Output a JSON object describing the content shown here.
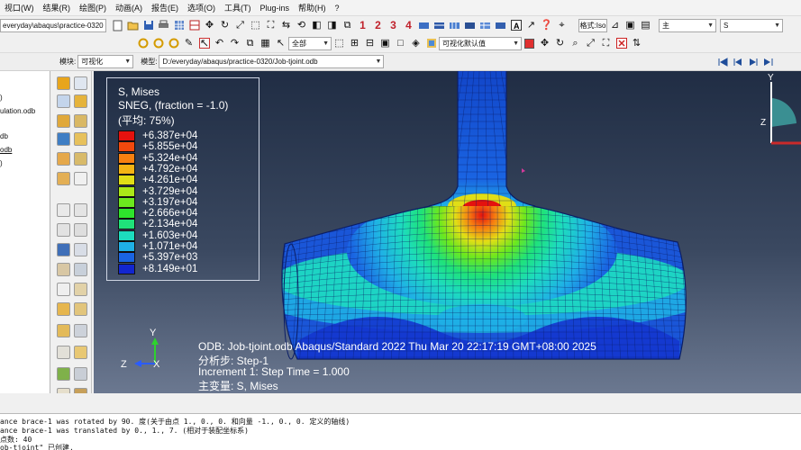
{
  "menu": [
    "视口(W)",
    "结果(R)",
    "绘图(P)",
    "动画(A)",
    "报告(E)",
    "选项(O)",
    "工具(T)",
    "Plug-ins",
    "帮助(H)",
    "?"
  ],
  "toolbar1": {
    "path": "everyday\\abaqus\\practice-0320",
    "numbers": [
      "1",
      "2",
      "3",
      "4"
    ],
    "system_label": "格式:Iso",
    "right_combo": "主",
    "right_combo2": "S"
  },
  "toolbar2": {
    "select_scope": "全部",
    "view_style": "可视化默认值"
  },
  "context": {
    "module_label": "模块:",
    "module_value": "可视化",
    "model_label": "模型:",
    "model_value": "D:/everyday/abaqus/practice-0320/Job-tjoint.odb"
  },
  "tree": {
    "items": [
      ")",
      "ulation.odb",
      "db",
      "odb",
      ")"
    ]
  },
  "legend": {
    "title_lines": [
      "S, Mises",
      "SNEG, (fraction = -1.0)",
      "(平均: 75%)"
    ],
    "levels": [
      {
        "value": "+6.387e+04",
        "color": "#e4120e"
      },
      {
        "value": "+5.855e+04",
        "color": "#f2490d"
      },
      {
        "value": "+5.324e+04",
        "color": "#f78010"
      },
      {
        "value": "+4.792e+04",
        "color": "#f4b414"
      },
      {
        "value": "+4.261e+04",
        "color": "#e1de16"
      },
      {
        "value": "+3.729e+04",
        "color": "#aae818"
      },
      {
        "value": "+3.197e+04",
        "color": "#6ce81e"
      },
      {
        "value": "+2.666e+04",
        "color": "#2ee42c"
      },
      {
        "value": "+2.134e+04",
        "color": "#1fe27a"
      },
      {
        "value": "+1.603e+04",
        "color": "#1ddcbe"
      },
      {
        "value": "+1.071e+04",
        "color": "#1fb0e6"
      },
      {
        "value": "+5.397e+03",
        "color": "#1a64e2"
      },
      {
        "value": "+8.149e+01",
        "color": "#1226cf"
      }
    ]
  },
  "viewport_info": {
    "line1": "ODB: Job-tjoint.odb    Abaqus/Standard 2022    Thu Mar 20 22:17:19 GMT+08:00 2025",
    "line2": "分析步: Step-1",
    "line3": "Increment      1: Step Time =     1.000",
    "line4": "主变量: S, Mises"
  },
  "triad": {
    "y": "Y",
    "z": "Z",
    "x": "X"
  },
  "view_cube": {
    "y": "Y",
    "z": "Z"
  },
  "messages": [
    "ance brace-1 was rotated by 90. 度(关于由点 1., 0., 0. 和向量 -1., 0., 0. 定义的轴线)",
    "ance brace-1 was translated by 0., 1., 7. (相对于装配坐标系)",
    "点数: 40",
    "ob-tjoint\" 已创建."
  ]
}
